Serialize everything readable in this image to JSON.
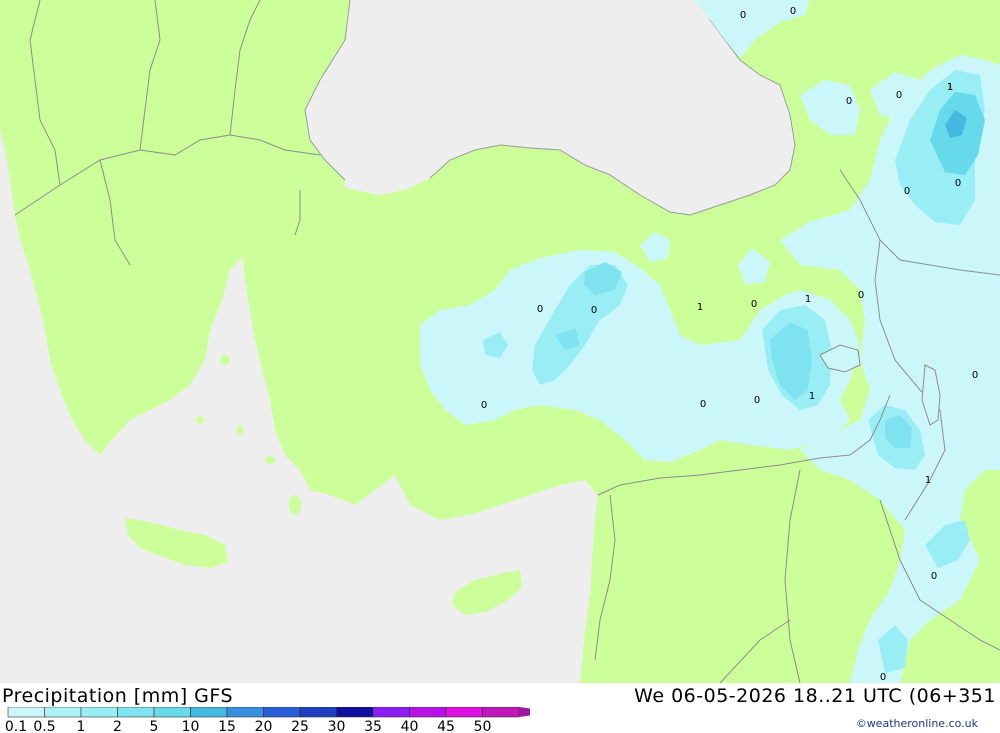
{
  "map": {
    "colors": {
      "sea": "#eeeeee",
      "land": "#ccff99",
      "precip_light": "#ccf7fa",
      "precip_mid": "#99eef5",
      "precip_heavy": "#66d9ea",
      "precip_max": "#44b9e0",
      "border": "#8c8c8c",
      "coast": "#9a9a9a"
    },
    "contour_labels": [
      {
        "text": "0"
      },
      {
        "text": "0"
      },
      {
        "text": "0"
      },
      {
        "text": "0"
      },
      {
        "text": "1"
      },
      {
        "text": "0"
      },
      {
        "text": "0"
      },
      {
        "text": "0"
      },
      {
        "text": "1"
      },
      {
        "text": "0"
      },
      {
        "text": "0"
      },
      {
        "text": "0"
      },
      {
        "text": "1"
      },
      {
        "text": "0"
      },
      {
        "text": "0"
      },
      {
        "text": "0"
      },
      {
        "text": "0"
      },
      {
        "text": "1"
      },
      {
        "text": "0"
      },
      {
        "text": "1"
      },
      {
        "text": "0"
      },
      {
        "text": "1"
      }
    ]
  },
  "footer": {
    "title": "Precipitation [mm] GFS",
    "timestamp": "We 06-05-2026 18..21 UTC (06+351",
    "credit": "©weatheronline.co.uk"
  },
  "legend": {
    "labels": [
      "0.1",
      "0.5",
      "1",
      "2",
      "5",
      "10",
      "15",
      "20",
      "25",
      "30",
      "35",
      "40",
      "45",
      "50"
    ],
    "colors": [
      "#ccf7fa",
      "#aef2f7",
      "#99eef5",
      "#7ee3ef",
      "#66d9ea",
      "#44b9e0",
      "#3a8ee0",
      "#2a5ed8",
      "#1f3fc0",
      "#120ea0",
      "#8a1ef0",
      "#b812e8",
      "#e010e0",
      "#c018b8"
    ],
    "arrow_color": "#a0189c"
  }
}
